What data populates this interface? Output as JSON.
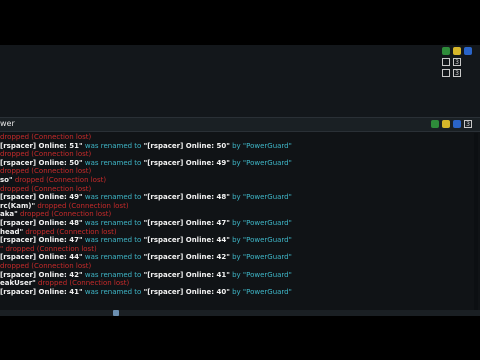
{
  "topic": {
    "text": "wer"
  },
  "chat_lines": [
    {
      "segments": [
        {
          "t": "dropped (Connection lost)",
          "c": "red"
        }
      ]
    },
    {
      "segments": [
        {
          "t": "[rspacer] Online: 51\"",
          "c": "white"
        },
        {
          "t": " was renamed to ",
          "c": "cyan"
        },
        {
          "t": "\"[rspacer] Online: 50\"",
          "c": "white"
        },
        {
          "t": " by ",
          "c": "cyan"
        },
        {
          "t": "\"PowerGuard\"",
          "c": "cyan"
        }
      ]
    },
    {
      "segments": [
        {
          "t": "dropped (Connection lost)",
          "c": "red"
        }
      ]
    },
    {
      "segments": [
        {
          "t": "[rspacer] Online: 50\"",
          "c": "white"
        },
        {
          "t": " was renamed to ",
          "c": "cyan"
        },
        {
          "t": "\"[rspacer] Online: 49\"",
          "c": "white"
        },
        {
          "t": " by ",
          "c": "cyan"
        },
        {
          "t": "\"PowerGuard\"",
          "c": "cyan"
        }
      ]
    },
    {
      "segments": [
        {
          "t": "dropped (Connection lost)",
          "c": "red"
        }
      ]
    },
    {
      "segments": [
        {
          "t": "so\"",
          "c": "white"
        },
        {
          "t": " dropped (Connection lost)",
          "c": "red"
        }
      ]
    },
    {
      "segments": [
        {
          "t": "dropped (Connection lost)",
          "c": "red"
        }
      ]
    },
    {
      "segments": [
        {
          "t": "[rspacer] Online: 49\"",
          "c": "white"
        },
        {
          "t": " was renamed to ",
          "c": "cyan"
        },
        {
          "t": "\"[rspacer] Online: 48\"",
          "c": "white"
        },
        {
          "t": " by ",
          "c": "cyan"
        },
        {
          "t": "\"PowerGuard\"",
          "c": "cyan"
        }
      ]
    },
    {
      "segments": [
        {
          "t": "rc(Kam)\"",
          "c": "white"
        },
        {
          "t": " dropped (Connection lost)",
          "c": "red"
        }
      ]
    },
    {
      "segments": [
        {
          "t": "aka\"",
          "c": "white"
        },
        {
          "t": " dropped (Connection lost)",
          "c": "red"
        }
      ]
    },
    {
      "segments": [
        {
          "t": "[rspacer] Online: 48\"",
          "c": "white"
        },
        {
          "t": " was renamed to ",
          "c": "cyan"
        },
        {
          "t": "\"[rspacer] Online: 47\"",
          "c": "white"
        },
        {
          "t": " by ",
          "c": "cyan"
        },
        {
          "t": "\"PowerGuard\"",
          "c": "cyan"
        }
      ]
    },
    {
      "segments": [
        {
          "t": "head\"",
          "c": "white"
        },
        {
          "t": " dropped (Connection lost)",
          "c": "red"
        }
      ]
    },
    {
      "segments": [
        {
          "t": "[rspacer] Online: 47\"",
          "c": "white"
        },
        {
          "t": " was renamed to ",
          "c": "cyan"
        },
        {
          "t": "\"[rspacer] Online: 44\"",
          "c": "white"
        },
        {
          "t": " by ",
          "c": "cyan"
        },
        {
          "t": "\"PowerGuard\"",
          "c": "cyan"
        }
      ]
    },
    {
      "segments": [
        {
          "t": "\" dropped (Connection lost)",
          "c": "red"
        }
      ]
    },
    {
      "segments": [
        {
          "t": "[rspacer] Online: 44\"",
          "c": "white"
        },
        {
          "t": " was renamed to ",
          "c": "cyan"
        },
        {
          "t": "\"[rspacer] Online: 42\"",
          "c": "white"
        },
        {
          "t": " by ",
          "c": "cyan"
        },
        {
          "t": "\"PowerGuard\"",
          "c": "cyan"
        }
      ]
    },
    {
      "segments": [
        {
          "t": "dropped (Connection lost)",
          "c": "red"
        }
      ]
    },
    {
      "segments": [
        {
          "t": "[rspacer] Online: 42\"",
          "c": "white"
        },
        {
          "t": " was renamed to ",
          "c": "cyan"
        },
        {
          "t": "\"[rspacer] Online: 41\"",
          "c": "white"
        },
        {
          "t": " by ",
          "c": "cyan"
        },
        {
          "t": "\"PowerGuard\"",
          "c": "cyan"
        }
      ]
    },
    {
      "segments": [
        {
          "t": "eakUser\"",
          "c": "white"
        },
        {
          "t": " dropped (Connection lost)",
          "c": "red"
        }
      ]
    },
    {
      "segments": [
        {
          "t": "[rspacer] Online: 41\"",
          "c": "white"
        },
        {
          "t": " was renamed to ",
          "c": "cyan"
        },
        {
          "t": "\"[rspacer] Online: 40\"",
          "c": "white"
        },
        {
          "t": " by ",
          "c": "cyan"
        },
        {
          "t": "\"PowerGuard\"",
          "c": "cyan"
        }
      ]
    }
  ],
  "icons": {
    "top_row_1": [
      "green-badge-icon",
      "yellow-badge-icon",
      "blue-badge-icon"
    ],
    "top_row_2": [
      "checkbox-icon",
      "number-3-icon"
    ],
    "topic_row": [
      "green-badge-icon",
      "yellow-badge-icon",
      "blue-badge-icon"
    ]
  },
  "badge_numbers": {
    "top": "3",
    "top2": "3",
    "topic": "3"
  },
  "colors": {
    "error": "#c72a2a",
    "rename": "#3fb7c8",
    "name": "#f2f2f2",
    "background": "#101316"
  }
}
